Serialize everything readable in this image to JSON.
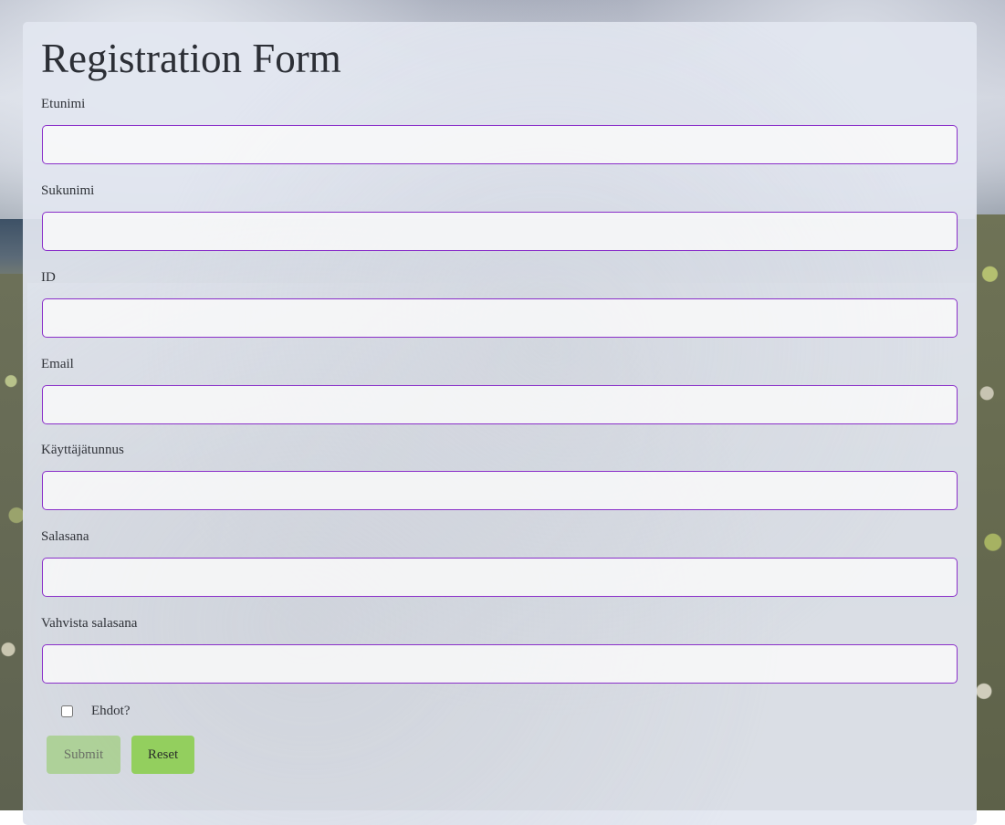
{
  "form": {
    "title": "Registration Form",
    "fields": [
      {
        "label": "Etunimi",
        "value": "",
        "placeholder": ""
      },
      {
        "label": "Sukunimi",
        "value": "",
        "placeholder": ""
      },
      {
        "label": "ID",
        "value": "",
        "placeholder": ""
      },
      {
        "label": "Email",
        "value": "",
        "placeholder": ""
      },
      {
        "label": "Käyttäjätunnus",
        "value": "",
        "placeholder": ""
      },
      {
        "label": "Salasana",
        "value": "",
        "placeholder": ""
      },
      {
        "label": "Vahvista salasana",
        "value": "",
        "placeholder": ""
      }
    ],
    "terms": {
      "label": "Ehdot?",
      "checked": false
    },
    "buttons": {
      "submit": "Submit",
      "reset": "Reset"
    }
  },
  "colors": {
    "input_border": "#8a2fc9",
    "submit_bg": "#a0ce80",
    "reset_bg": "#93cf5e",
    "panel_bg": "#e2e6f0"
  }
}
